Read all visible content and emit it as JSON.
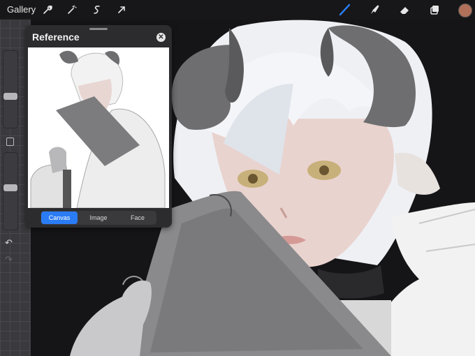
{
  "topbar": {
    "gallery_label": "Gallery",
    "left_tools": [
      "wrench-icon",
      "magic-wand-icon",
      "selection-icon",
      "transform-arrow-icon"
    ],
    "right_tools": [
      "brush-icon",
      "smudge-icon",
      "eraser-icon",
      "layers-icon"
    ],
    "current_color": "#b0705a"
  },
  "sidebar": {
    "brush_size_level": 0.4,
    "opacity_level": 0.55
  },
  "reference": {
    "title": "Reference",
    "tabs": [
      {
        "label": "Canvas",
        "active": true
      },
      {
        "label": "Image",
        "active": false
      },
      {
        "label": "Face",
        "active": false
      }
    ]
  },
  "colors": {
    "accent": "#2a7cf4",
    "background": "#151517"
  }
}
